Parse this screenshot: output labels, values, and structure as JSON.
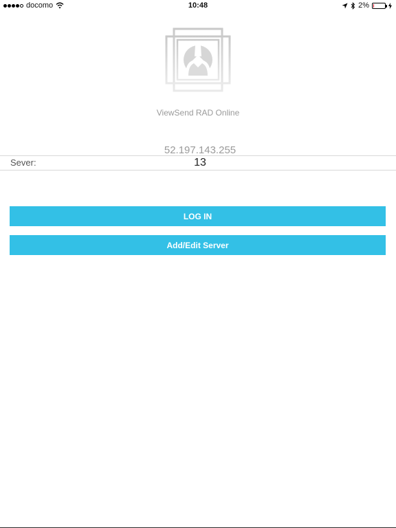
{
  "status_bar": {
    "carrier": "docomo",
    "time": "10:48",
    "battery_percent_label": "2%",
    "battery_level": 0.02,
    "signal_bars_filled": 4,
    "signal_bars_total": 5,
    "icons": [
      "wifi-icon",
      "location-arrow-icon",
      "bluetooth-icon",
      "battery-icon",
      "charging-bolt-icon"
    ]
  },
  "app": {
    "logo_icon": "viewsend-logo-icon",
    "title": "ViewSend RAD Online"
  },
  "server": {
    "address": "52.197.143.255",
    "label": "Sever:",
    "value": "13"
  },
  "buttons": {
    "login_label": "LOG IN",
    "add_edit_server_label": "Add/Edit Server"
  },
  "colors": {
    "accent": "#33c0e6",
    "muted_text": "#9a9a9a",
    "battery_low": "#e0182d"
  }
}
